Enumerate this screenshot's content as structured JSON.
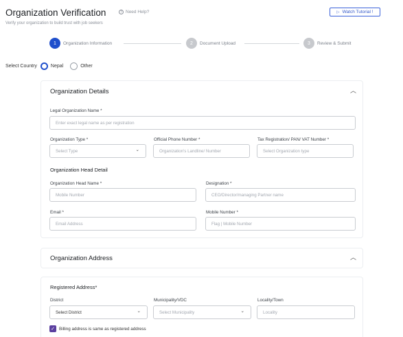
{
  "header": {
    "title": "Organization Verification",
    "help_label": "Need Help?",
    "subtitle": "Verify your organization to build trust with job seekers",
    "watch_tutorial": "Watch Tutorial !"
  },
  "stepper": {
    "steps": [
      {
        "number": "1",
        "label": "Organization Information",
        "state": "active"
      },
      {
        "number": "2",
        "label": "Document Upload",
        "state": "inactive"
      },
      {
        "number": "3",
        "label": "Review & Submit",
        "state": "inactive"
      }
    ]
  },
  "country": {
    "label": "Select Country",
    "options": [
      {
        "label": "Nepal",
        "selected": true
      },
      {
        "label": "Other",
        "selected": false
      }
    ]
  },
  "org_details": {
    "title": "Organization Details",
    "legal_name": {
      "label": "Legal Organization Name *",
      "placeholder": "Enter exact legal name as per registration"
    },
    "org_type": {
      "label": "Organization Type *",
      "value": "Select Type"
    },
    "phone": {
      "label": "Official Phone Number *",
      "placeholder": "Organization's Landline/ Number"
    },
    "tax": {
      "label": "Tax Registration/ PAN/ VAT Number *",
      "placeholder": "Select Organization type"
    },
    "head_section": "Organization Head Detail",
    "head_name": {
      "label": "Organization Head Name *",
      "placeholder": "Mobile Number"
    },
    "designation": {
      "label": "Designation *",
      "placeholder": "CEO/Director/managing Partner name"
    },
    "email": {
      "label": "Email *",
      "placeholder": "Email Address"
    },
    "mobile": {
      "label": "Mobile Number *",
      "placeholder": "Flag | Mobile Number"
    }
  },
  "org_address": {
    "title": "Organization Address",
    "registered_heading": "Registered Address*",
    "district": {
      "label": "District",
      "value": "Select District"
    },
    "municipality": {
      "label": "Municipality/VDC",
      "value": "Select Municipality"
    },
    "locality": {
      "label": "Locality/Town",
      "placeholder": "Locality"
    },
    "billing_same": "Billing address is same as registered address"
  },
  "colors": {
    "accent": "#1f4fcc",
    "checkbox": "#5b3f9f"
  }
}
